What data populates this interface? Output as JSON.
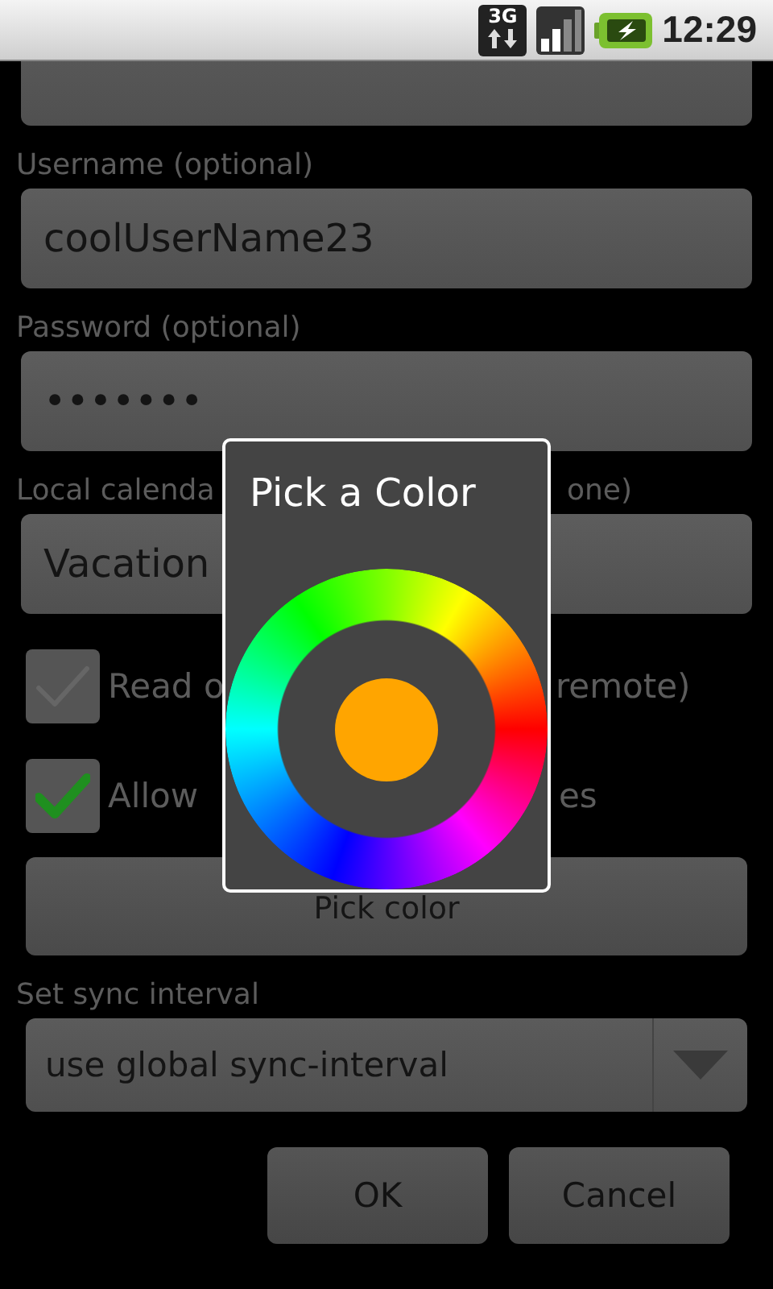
{
  "status_bar": {
    "network": "3G",
    "time": "12:29"
  },
  "form": {
    "url_field": {
      "kind": "field"
    },
    "username": {
      "label": "Username (optional)",
      "value": "coolUserName23"
    },
    "password": {
      "label": "Password (optional)",
      "value": "•••••••"
    },
    "local_calendar": {
      "label_left": "Local calenda",
      "label_right": "one)",
      "value": "Vacation"
    },
    "checkboxes": [
      {
        "label_left": "Read o",
        "label_right": "remote)",
        "checked": false
      },
      {
        "label_left": "Allow",
        "label_right": "es",
        "checked": true
      }
    ],
    "pick_color_button": "Pick color",
    "sync_interval": {
      "label": "Set sync interval",
      "value": "use global sync-interval"
    },
    "buttons": [
      "OK",
      "Cancel"
    ]
  },
  "dialog": {
    "title": "Pick a Color",
    "swatch": {
      "color": "#ffa500"
    }
  }
}
